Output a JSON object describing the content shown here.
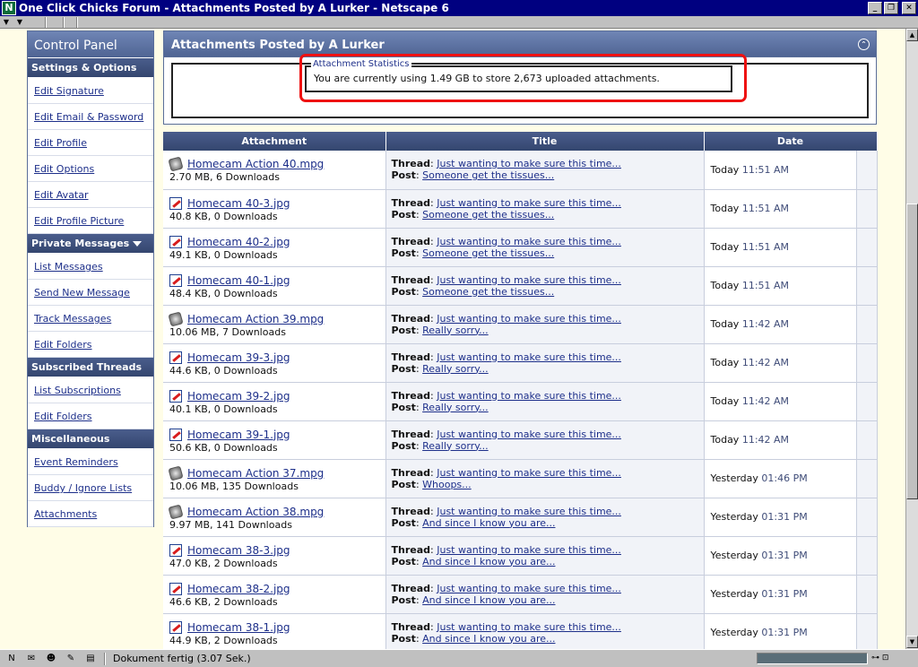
{
  "window": {
    "title": "One Click Chicks Forum - Attachments Posted by A Lurker - Netscape 6",
    "app_icon": "N",
    "btn_min": "_",
    "btn_max": "❐",
    "btn_close": "✕"
  },
  "control_panel": {
    "title": "Control Panel",
    "sections": [
      {
        "heading": "Settings & Options",
        "collapsible": false,
        "items": [
          "Edit Signature",
          "Edit Email & Password",
          "Edit Profile",
          "Edit Options",
          "Edit Avatar",
          "Edit Profile Picture"
        ]
      },
      {
        "heading": "Private Messages",
        "collapsible": true,
        "items": [
          "List Messages",
          "Send New Message",
          "Track Messages",
          "Edit Folders"
        ]
      },
      {
        "heading": "Subscribed Threads",
        "collapsible": true,
        "items": [
          "List Subscriptions",
          "Edit Folders"
        ]
      },
      {
        "heading": "Miscellaneous",
        "collapsible": false,
        "items": [
          "Event Reminders",
          "Buddy / Ignore Lists",
          "Attachments"
        ]
      }
    ]
  },
  "main": {
    "title": "Attachments Posted by A Lurker",
    "stats_legend": "Attachment Statistics",
    "stats_text": "You are currently using 1.49 GB to store 2,673 uploaded attachments.",
    "columns": [
      "Attachment",
      "Title",
      "Date"
    ],
    "thread_label": "Thread",
    "post_label": "Post",
    "rows": [
      {
        "type": "mpg",
        "name": "Homecam Action 40.mpg",
        "meta": "2.70 MB, 6 Downloads",
        "thread": "Just wanting to make sure this time...",
        "post": "Someone get the tissues...",
        "day": "Today",
        "time": "11:51 AM"
      },
      {
        "type": "jpg",
        "name": "Homecam  40-3.jpg",
        "meta": "40.8 KB, 0 Downloads",
        "thread": "Just wanting to make sure this time...",
        "post": "Someone get the tissues...",
        "day": "Today",
        "time": "11:51 AM"
      },
      {
        "type": "jpg",
        "name": "Homecam   40-2.jpg",
        "meta": "49.1 KB, 0 Downloads",
        "thread": "Just wanting to make sure this time...",
        "post": "Someone get the tissues...",
        "day": "Today",
        "time": "11:51 AM"
      },
      {
        "type": "jpg",
        "name": "Homecam   40-1.jpg",
        "meta": "48.4 KB, 0 Downloads",
        "thread": "Just wanting to make sure this time...",
        "post": "Someone get the tissues...",
        "day": "Today",
        "time": "11:51 AM"
      },
      {
        "type": "mpg",
        "name": "Homecam Action 39.mpg",
        "meta": "10.06 MB, 7 Downloads",
        "thread": "Just wanting to make sure this time...",
        "post": "Really sorry...",
        "day": "Today",
        "time": "11:42 AM"
      },
      {
        "type": "jpg",
        "name": "Homecam   39-3.jpg",
        "meta": "44.6 KB, 0 Downloads",
        "thread": "Just wanting to make sure this time...",
        "post": "Really sorry...",
        "day": "Today",
        "time": "11:42 AM"
      },
      {
        "type": "jpg",
        "name": "Homecam   39-2.jpg",
        "meta": "40.1 KB, 0 Downloads",
        "thread": "Just wanting to make sure this time...",
        "post": "Really sorry...",
        "day": "Today",
        "time": "11:42 AM"
      },
      {
        "type": "jpg",
        "name": "Homecam   39-1.jpg",
        "meta": "50.6 KB, 0 Downloads",
        "thread": "Just wanting to make sure this time...",
        "post": "Really sorry...",
        "day": "Today",
        "time": "11:42 AM"
      },
      {
        "type": "mpg",
        "name": "Homecam Action 37.mpg",
        "meta": "10.06 MB, 135 Downloads",
        "thread": "Just wanting to make sure this time...",
        "post": "Whoops...",
        "day": "Yesterday",
        "time": "01:46 PM"
      },
      {
        "type": "mpg",
        "name": "Homecam Action 38.mpg",
        "meta": "9.97 MB, 141 Downloads",
        "thread": "Just wanting to make sure this time...",
        "post": "And since I know you are...",
        "day": "Yesterday",
        "time": "01:31 PM"
      },
      {
        "type": "jpg",
        "name": "Homecam   38-3.jpg",
        "meta": "47.0 KB, 2 Downloads",
        "thread": "Just wanting to make sure this time...",
        "post": "And since I know you are...",
        "day": "Yesterday",
        "time": "01:31 PM"
      },
      {
        "type": "jpg",
        "name": "Homecam   38-2.jpg",
        "meta": "46.6 KB, 2 Downloads",
        "thread": "Just wanting to make sure this time...",
        "post": "And since I know you are...",
        "day": "Yesterday",
        "time": "01:31 PM"
      },
      {
        "type": "jpg",
        "name": "Homecam   38-1.jpg",
        "meta": "44.9 KB, 2 Downloads",
        "thread": "Just wanting to make sure this time...",
        "post": "And since I know you are...",
        "day": "Yesterday",
        "time": "01:31 PM"
      }
    ]
  },
  "statusbar": {
    "text": "Dokument fertig (3.07 Sek.)",
    "icons": [
      "netscape-icon",
      "mail-icon",
      "aim-icon",
      "composer-icon",
      "address-book-icon"
    ],
    "icon_glyphs": [
      "N",
      "✉",
      "☻",
      "✎",
      "▤"
    ]
  },
  "colors": {
    "titlebar": "#000080",
    "panel_header": "#4f6493",
    "category": "#34466f",
    "link": "#1d2f8a",
    "highlight": "#ee1111",
    "background": "#fffde7"
  }
}
